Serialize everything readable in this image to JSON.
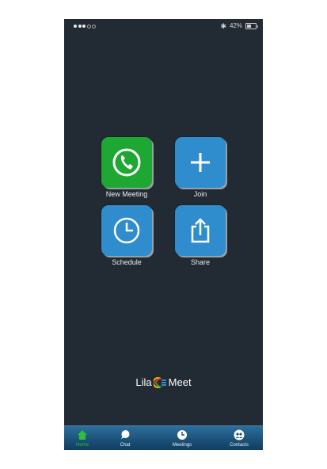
{
  "status_bar": {
    "battery_percent": "42%"
  },
  "actions": [
    {
      "label": "New Meeting",
      "icon": "phone-icon",
      "color": "#1fa733"
    },
    {
      "label": "Join",
      "icon": "plus-icon",
      "color": "#2f8dcd"
    },
    {
      "label": "Schedule",
      "icon": "clock-icon",
      "color": "#2f8dcd"
    },
    {
      "label": "Share",
      "icon": "share-icon",
      "color": "#2f8dcd"
    }
  ],
  "logo": {
    "text_left": "Lila",
    "text_right": "Meet"
  },
  "tabs": [
    {
      "label": "Home",
      "icon": "home-icon",
      "active": true
    },
    {
      "label": "Chat",
      "icon": "chat-icon",
      "active": false
    },
    {
      "label": "Meetings",
      "icon": "meetings-icon",
      "active": false
    },
    {
      "label": "Contacts",
      "icon": "contacts-icon",
      "active": false
    }
  ],
  "colors": {
    "background": "#222a33",
    "accent_green": "#1fa733",
    "accent_blue": "#2f8dcd",
    "active_tab": "#2fbf3a"
  }
}
